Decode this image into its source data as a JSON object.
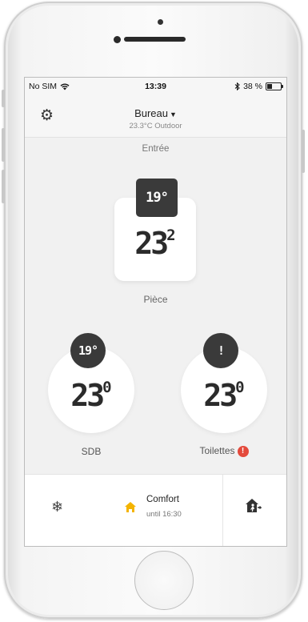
{
  "status_bar": {
    "carrier": "No SIM",
    "time": "13:39",
    "battery": "38 %",
    "battery_level": 0.38
  },
  "header": {
    "home_name": "Bureau",
    "outdoor": "23.3°C Outdoor"
  },
  "rooms": {
    "top_label": "Entrée",
    "main": {
      "name": "Pièce",
      "setpoint": "19°",
      "temp_int": "23",
      "temp_dec": "2"
    },
    "left": {
      "name": "SDB",
      "setpoint": "19°",
      "temp_int": "23",
      "temp_dec": "0"
    },
    "right": {
      "name": "Toilettes",
      "badge": "!",
      "alert": "!",
      "temp_int": "23",
      "temp_dec": "0"
    }
  },
  "bottom_bar": {
    "mode_title": "Comfort",
    "mode_sub": "until 16:30"
  },
  "icons": {
    "settings": "gear-icon",
    "frost": "snowflake-icon",
    "mode": "home-icon",
    "away": "away-house-icon"
  },
  "colors": {
    "badge_dark": "#3a3a3a",
    "alert_red": "#e44a3c",
    "mode_yellow": "#f4b400"
  }
}
